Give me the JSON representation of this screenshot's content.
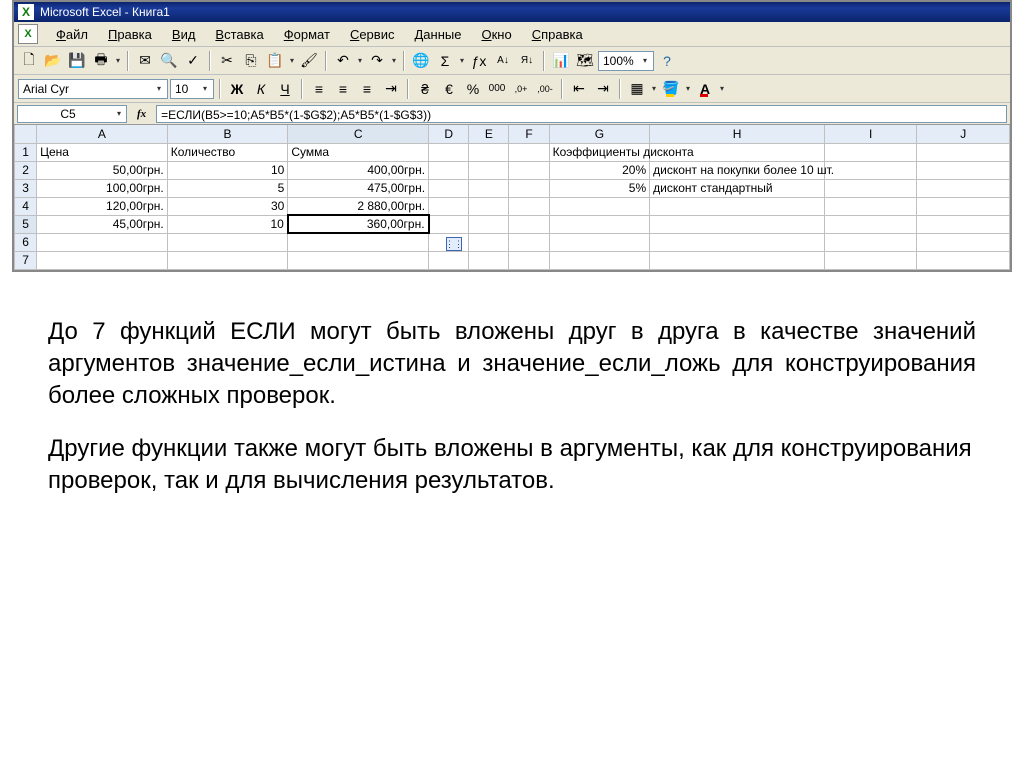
{
  "window": {
    "title": "Microsoft Excel - Книга1"
  },
  "menu": [
    "Файл",
    "Правка",
    "Вид",
    "Вставка",
    "Формат",
    "Сервис",
    "Данные",
    "Окно",
    "Справка"
  ],
  "font": {
    "name": "Arial Cyr",
    "size": "10"
  },
  "zoom": "100%",
  "namebox": "C5",
  "formula": "=ЕСЛИ(B5>=10;A5*B5*(1-$G$2);A5*B5*(1-$G$3))",
  "columns": [
    "A",
    "B",
    "C",
    "D",
    "E",
    "F",
    "G",
    "H",
    "I",
    "J"
  ],
  "rows": [
    {
      "n": "1",
      "A": "Цена",
      "B": "Количество",
      "C": "Сумма",
      "G": "Коэффициенты дисконта",
      "_left": [
        "A",
        "B",
        "C",
        "G"
      ]
    },
    {
      "n": "2",
      "A": "50,00грн.",
      "B": "10",
      "C": "400,00грн.",
      "G": "20%",
      "H": "дисконт на покупки более 10 шт."
    },
    {
      "n": "3",
      "A": "100,00грн.",
      "B": "5",
      "C": "475,00грн.",
      "G": "5%",
      "H": "дисконт стандартный"
    },
    {
      "n": "4",
      "A": "120,00грн.",
      "B": "30",
      "C": "2 880,00грн."
    },
    {
      "n": "5",
      "A": "45,00грн.",
      "B": "10",
      "C": "360,00грн."
    },
    {
      "n": "6"
    },
    {
      "n": "7"
    }
  ],
  "colWidths": {
    "_row": 22,
    "A": 130,
    "B": 120,
    "C": 140,
    "D": 40,
    "E": 40,
    "F": 40,
    "G": 100,
    "H": 174,
    "I": 92,
    "J": 92
  },
  "selectedCell": {
    "row": "5",
    "col": "C"
  },
  "bodyText": {
    "p1": "До 7 функций ЕСЛИ могут быть вложены друг в друга в качестве значений аргументов значение_если_истина и значение_если_ложь для конструирования более сложных проверок.",
    "p2": "Другие функции также могут быть вложены в аргументы, как для конструирования проверок, так и для вычисления результатов."
  }
}
